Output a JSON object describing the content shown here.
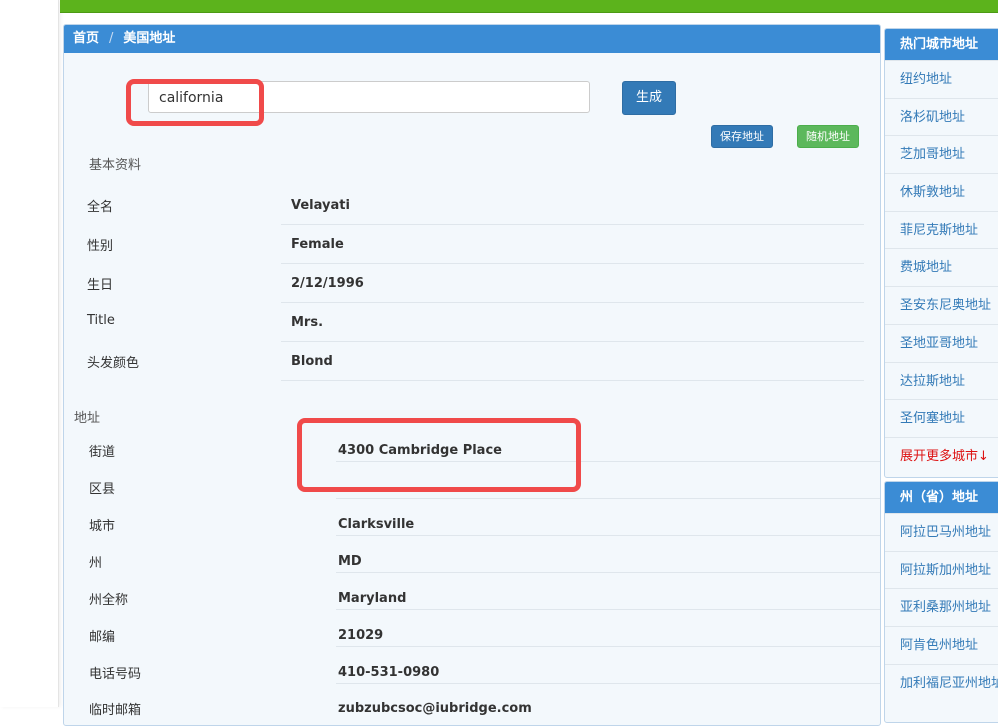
{
  "breadcrumb": {
    "home": "首页",
    "separator": "/",
    "current": "美国地址"
  },
  "search": {
    "value": "california"
  },
  "buttons": {
    "generate": "生成",
    "save": "保存地址",
    "random": "随机地址"
  },
  "basic_info": {
    "title": "基本资料",
    "rows": [
      {
        "label": "全名",
        "value": "Velayati"
      },
      {
        "label": "性别",
        "value": "Female"
      },
      {
        "label": "生日",
        "value": "2/12/1996"
      },
      {
        "label": "Title",
        "value": "Mrs."
      },
      {
        "label": "头发颜色",
        "value": "Blond"
      }
    ]
  },
  "address": {
    "title": "地址",
    "rows": [
      {
        "label": "街道",
        "value": "4300  Cambridge Place"
      },
      {
        "label": "区县",
        "value": ""
      },
      {
        "label": "城市",
        "value": "Clarksville"
      },
      {
        "label": "州",
        "value": "MD"
      },
      {
        "label": "州全称",
        "value": "Maryland"
      },
      {
        "label": "邮编",
        "value": "21029"
      },
      {
        "label": "电话号码",
        "value": "410-531-0980"
      },
      {
        "label": "临时邮箱",
        "value": "zubzubcsoc@iubridge.com"
      }
    ]
  },
  "sidebar": {
    "hot_cities": {
      "title": "热门城市地址",
      "items": [
        "纽约地址",
        "洛杉矶地址",
        "芝加哥地址",
        "休斯敦地址",
        "菲尼克斯地址",
        "费城地址",
        "圣安东尼奥地址",
        "圣地亚哥地址",
        "达拉斯地址",
        "圣何塞地址"
      ],
      "more": "展开更多城市↓"
    },
    "states": {
      "title": "州（省）地址",
      "items": [
        "阿拉巴马州地址",
        "阿拉斯加州地址",
        "亚利桑那州地址",
        "阿肯色州地址",
        "加利福尼亚州地址"
      ]
    }
  },
  "colors": {
    "top_bar": "#5cb31c",
    "panel_heading": "#3b8cd5",
    "primary_button": "#337ab7",
    "success_button": "#5cb85c",
    "highlight": "#f04a4a",
    "link": "#337ab7",
    "more_link": "#dd1111"
  }
}
